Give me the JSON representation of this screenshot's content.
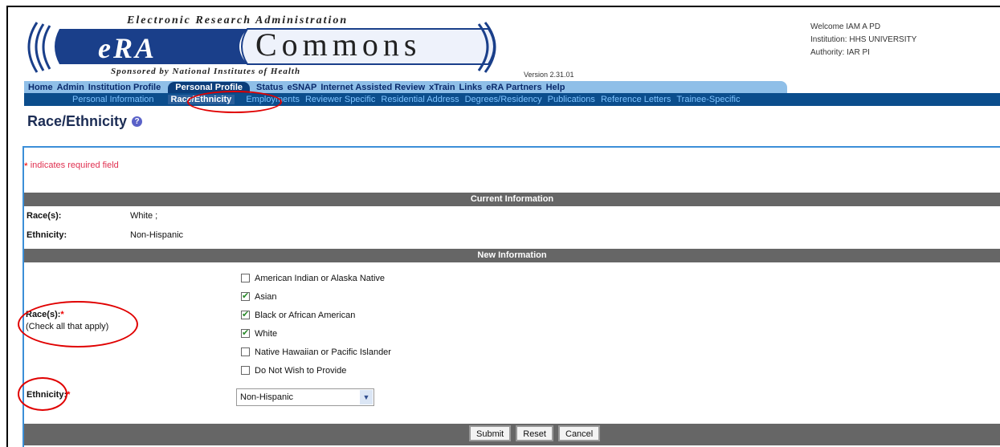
{
  "header": {
    "title_top": "Electronic Research Administration",
    "logo_era": "eRA",
    "logo_commons": "Commons",
    "sponsored": "Sponsored by National Institutes of Health",
    "version": "Version 2.31.01"
  },
  "user": {
    "welcome": "Welcome IAM A PD",
    "institution": "Institution: HHS UNIVERSITY",
    "authority": "Authority:  IAR  PI"
  },
  "mainnav": {
    "items": [
      "Home",
      "Admin",
      "Institution Profile",
      "Personal Profile",
      "Status",
      "eSNAP",
      "Internet Assisted Review",
      "xTrain",
      "Links",
      "eRA Partners",
      "Help"
    ]
  },
  "subnav": {
    "items": [
      "Personal Information",
      "Race/Ethnicity",
      "Employments",
      "Reviewer Specific",
      "Residential Address",
      "Degrees/Residency",
      "Publications",
      "Reference Letters",
      "Trainee-Specific"
    ]
  },
  "page": {
    "title": "Race/Ethnicity",
    "help_icon": "?",
    "required_note": "indicates required field",
    "required_star": "*"
  },
  "current": {
    "heading": "Current Information",
    "race_label": "Race(s):",
    "race_value": "White ;",
    "ethnicity_label": "Ethnicity:",
    "ethnicity_value": "Non-Hispanic"
  },
  "new_info": {
    "heading": "New Information",
    "race_label": "Race(s):",
    "race_hint": "(Check all that apply)",
    "races": [
      {
        "label": "American Indian or Alaska Native",
        "checked": false
      },
      {
        "label": "Asian",
        "checked": true
      },
      {
        "label": "Black or African American",
        "checked": true
      },
      {
        "label": "White",
        "checked": true
      },
      {
        "label": "Native Hawaiian or Pacific Islander",
        "checked": false
      },
      {
        "label": "Do Not Wish to Provide",
        "checked": false
      }
    ],
    "ethnicity_label": "Ethnicity:",
    "ethnicity_selected": "Non-Hispanic"
  },
  "buttons": {
    "submit": "Submit",
    "reset": "Reset",
    "cancel": "Cancel"
  },
  "colors": {
    "subnav_bg": "#0b4d8c",
    "mainnav_bg": "#8fbfe8",
    "bar_bg": "#666666",
    "annotation": "#e00000"
  }
}
